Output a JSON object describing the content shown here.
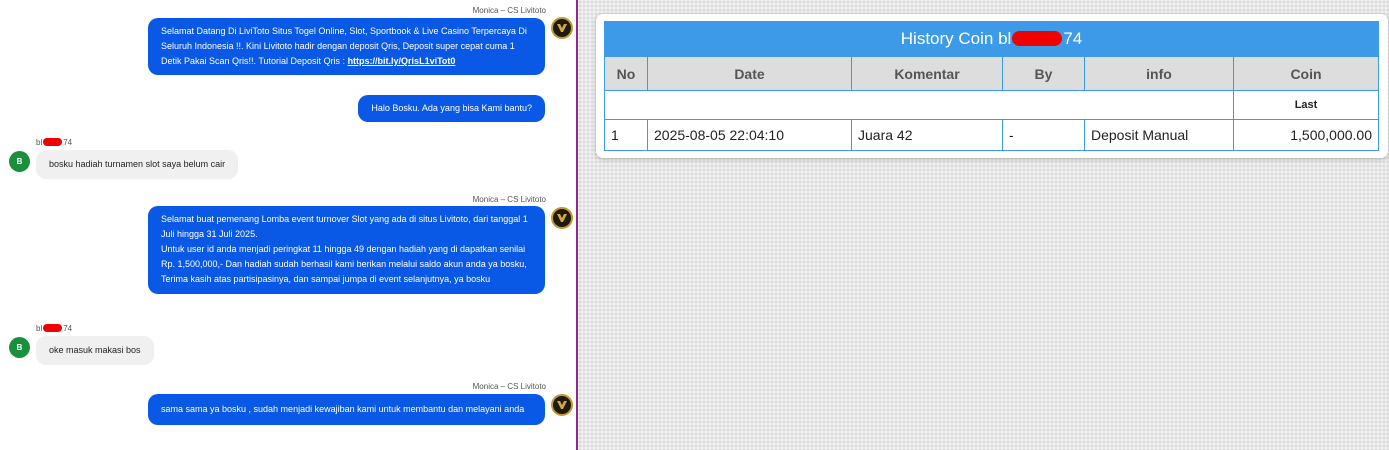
{
  "chat": {
    "messages": [
      {
        "sender": "Monica – CS Livitoto",
        "text": "Selamat Datang Di LiviToto Situs Togel Online, Slot, Sportbook & Live Casino Terpercaya Di Seluruh Indonesia !!. Kini Livitoto hadir dengan deposit Qris, Deposit super cepat cuma 1 Detik Pakai Scan Qris!!. Tutorial Deposit Qris : ",
        "link": "https://bit.ly/QrisL1viTot0"
      },
      {
        "text": "Halo Bosku. Ada yang bisa Kami bantu?"
      },
      {
        "sender_prefix": "bl",
        "sender_suffix": "74",
        "avatar_letter": "B",
        "text": "bosku hadiah turnamen slot saya belum cair"
      },
      {
        "sender": "Monica – CS Livitoto",
        "text_lines": [
          "Selamat buat pemenang Lomba event turnover Slot yang ada di situs Livitoto, dari tanggal 1 Juli hingga 31 Juli 2025.",
          "Untuk user id anda menjadi peringkat 11 hingga 49 dengan hadiah yang di dapatkan senilai Rp. 1,500,000,- Dan hadiah sudah berhasil kami berikan melalui saldo akun anda ya bosku, Terima kasih atas partisipasinya, dan sampai jumpa di event selanjutnya, ya bosku"
        ]
      },
      {
        "sender_prefix": "bl",
        "sender_suffix": "74",
        "avatar_letter": "B",
        "text": "oke masuk makasi bos"
      },
      {
        "sender": "Monica – CS Livitoto",
        "text": "sama sama ya bosku , sudah menjadi kewajiban kami untuk membantu dan melayani anda"
      }
    ]
  },
  "history": {
    "title_prefix": "History Coin bl",
    "title_suffix": "74",
    "columns": [
      "No",
      "Date",
      "Komentar",
      "By",
      "info",
      "Coin"
    ],
    "last_label": "Last",
    "rows": [
      {
        "no": "1",
        "date": "2025-08-05 22:04:10",
        "komentar": "Juara 42",
        "by": "-",
        "info": "Deposit Manual",
        "coin": "1,500,000.00"
      }
    ]
  },
  "colors": {
    "agent_bubble": "#0a59e6",
    "user_avatar": "#1a8f3c",
    "table_header": "#3d9ae8",
    "coin_value": "#1b8a1b",
    "divider": "#8a2b8a"
  },
  "icons": {
    "agent_avatar": "livitoto-logo-icon",
    "user_avatar": "user-initial-avatar"
  }
}
